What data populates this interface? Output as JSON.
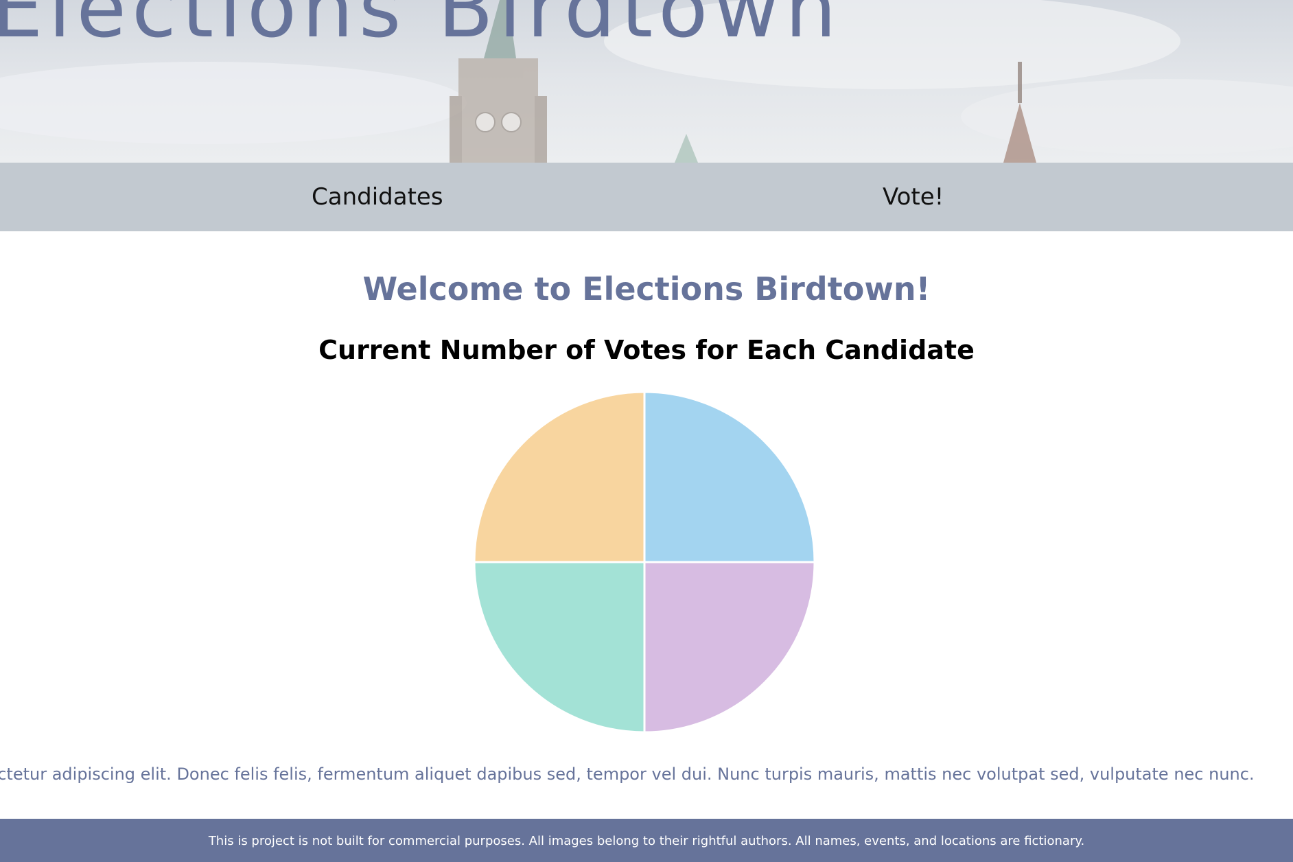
{
  "hero": {
    "title": "Elections Birdtown"
  },
  "nav": {
    "items": [
      {
        "label": "Candidates"
      },
      {
        "label": "Vote!"
      }
    ]
  },
  "main": {
    "welcome": "Welcome to Elections Birdtown!",
    "chart_title": "Current Number of Votes for Each Candidate",
    "lorem": "Lorem ipsum dolor sit amet, consectetur adipiscing elit. Donec felis felis, fermentum aliquet dapibus sed, tempor vel dui. Nunc turpis mauris, mattis nec volutpat sed, vulputate nec nunc."
  },
  "footer": {
    "text": "This is project is not built for commercial purposes. All images belong to their rightful authors. All names, events, and locations are fictionary."
  },
  "chart_data": {
    "type": "pie",
    "title": "Current Number of Votes for Each Candidate",
    "values": [
      1,
      1,
      1,
      1
    ],
    "colors": [
      "#a3d4f0",
      "#d7bce2",
      "#a3e2d6",
      "#f8d59f"
    ],
    "slice_order": "clockwise from top"
  }
}
